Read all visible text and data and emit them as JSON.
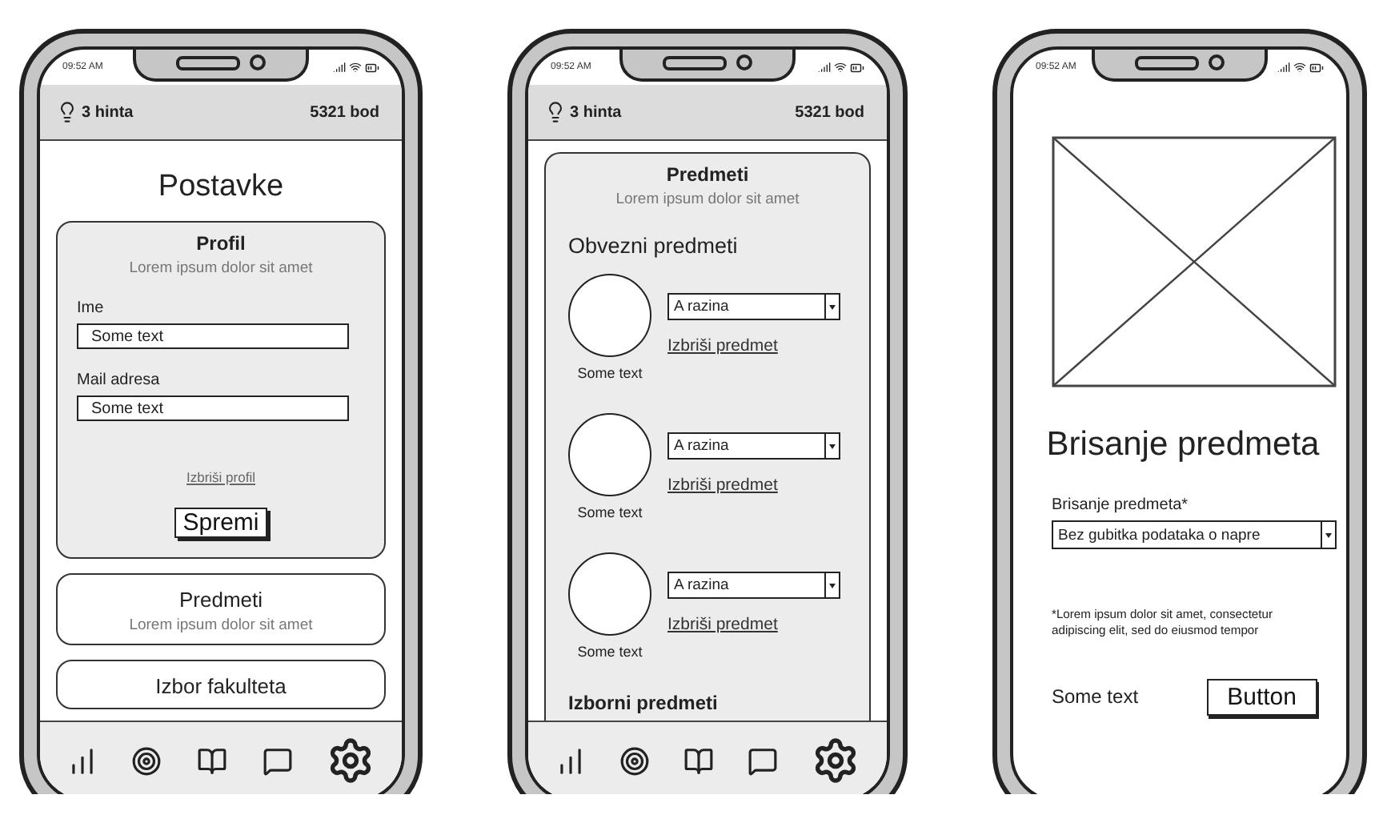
{
  "phones": [
    {
      "kind": "settings",
      "status": {
        "time": "09:52 AM"
      },
      "header": {
        "hints": "3 hinta",
        "points": "5321 bod"
      },
      "title": "Postavke",
      "profile": {
        "title": "Profil",
        "subtitle": "Lorem ipsum dolor sit amet",
        "fields": [
          {
            "label": "Ime",
            "value": "Some text"
          },
          {
            "label": "Mail adresa",
            "value": "Some text"
          }
        ],
        "delete_link": "Izbriši profil",
        "save_button": "Spremi"
      },
      "cards": [
        {
          "title": "Predmeti",
          "subtitle": "Lorem ipsum dolor sit amet"
        },
        {
          "title": "Izbor fakulteta"
        }
      ],
      "nav": [
        {
          "kind": "stats",
          "selected": false
        },
        {
          "kind": "goals",
          "selected": false
        },
        {
          "kind": "book",
          "selected": false
        },
        {
          "kind": "chat",
          "selected": false
        },
        {
          "kind": "settings",
          "selected": true
        }
      ]
    },
    {
      "kind": "subjects",
      "status": {
        "time": "09:52 AM"
      },
      "header": {
        "hints": "3 hinta",
        "points": "5321 bod"
      },
      "panel": {
        "title": "Predmeti",
        "subtitle": "Lorem ipsum dolor sit amet",
        "section": "Obvezni predmeti",
        "subjects": [
          {
            "caption": "Some text",
            "level": "A razina",
            "delete_link": "Izbriši predmet"
          },
          {
            "caption": "Some text",
            "level": "A razina",
            "delete_link": "Izbriši predmet"
          },
          {
            "caption": "Some text",
            "level": "A razina",
            "delete_link": "Izbriši predmet"
          }
        ],
        "next_section": "Izborni predmeti"
      },
      "nav": [
        {
          "kind": "stats",
          "selected": false
        },
        {
          "kind": "goals",
          "selected": false
        },
        {
          "kind": "book",
          "selected": false
        },
        {
          "kind": "chat",
          "selected": false
        },
        {
          "kind": "settings",
          "selected": true
        }
      ]
    },
    {
      "kind": "delete",
      "status": {
        "time": "09:52 AM"
      },
      "title": "Brisanje predmeta",
      "field_label": "Brisanje predmeta*",
      "select_value": "Bez gubitka podataka o napre",
      "note": "*Lorem ipsum dolor sit amet, consectetur adipiscing elit, sed do eiusmod tempor",
      "footer_text": "Some text",
      "button": "Button"
    }
  ]
}
